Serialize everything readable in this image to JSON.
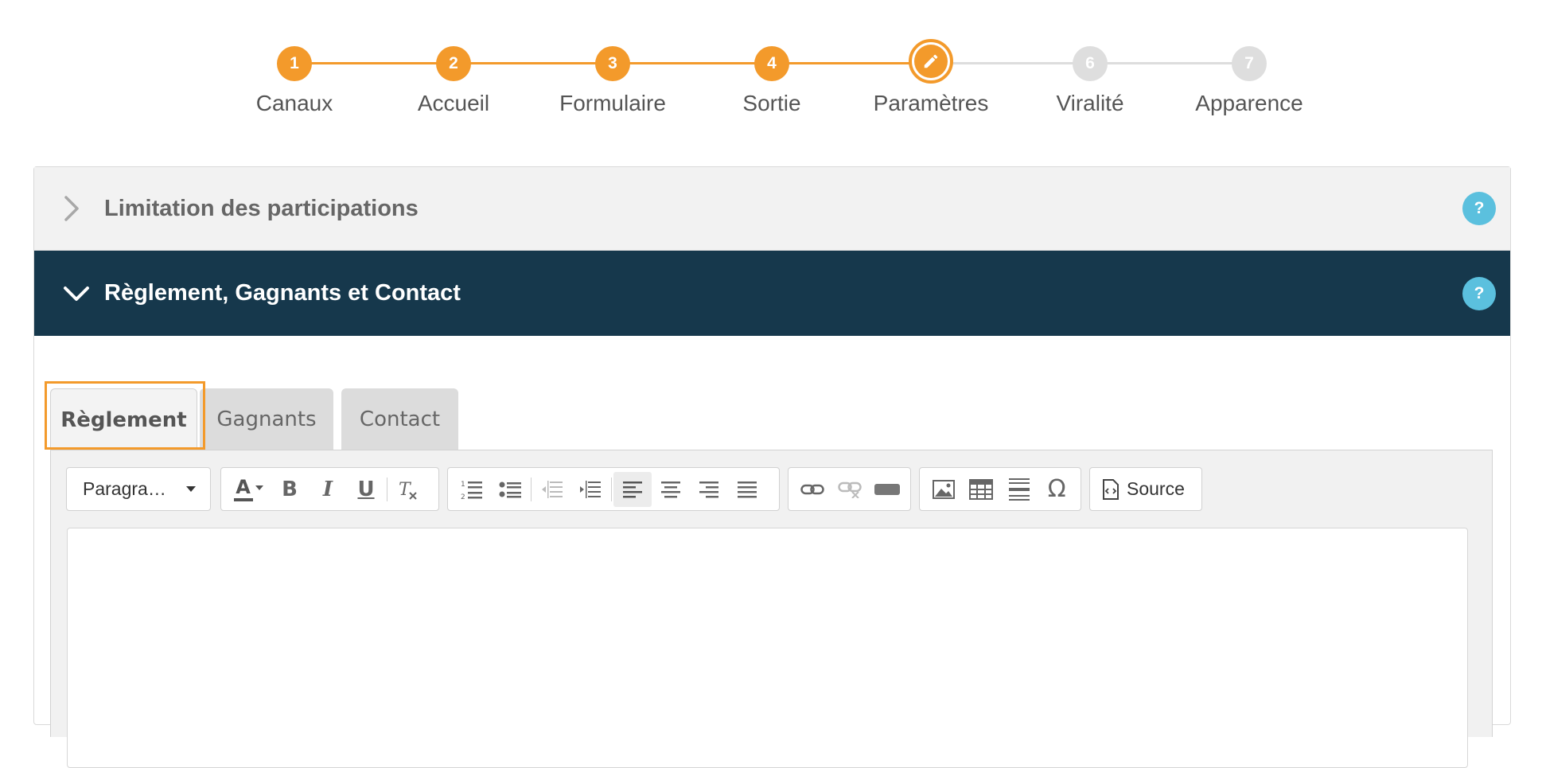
{
  "stepper": {
    "steps": [
      {
        "number": "1",
        "label": "Canaux"
      },
      {
        "number": "2",
        "label": "Accueil"
      },
      {
        "number": "3",
        "label": "Formulaire"
      },
      {
        "number": "4",
        "label": "Sortie"
      },
      {
        "number": "",
        "label": "Paramètres"
      },
      {
        "number": "6",
        "label": "Viralité"
      },
      {
        "number": "7",
        "label": "Apparence"
      }
    ],
    "active_step": 5,
    "active_icon": "pencil-icon"
  },
  "panels": {
    "limitation": {
      "title": "Limitation des participations",
      "help": "?",
      "state": "collapsed"
    },
    "reglement": {
      "title": "Règlement, Gagnants et Contact",
      "help": "?",
      "state": "expanded"
    }
  },
  "tabs": [
    {
      "label": "Règlement",
      "active": true
    },
    {
      "label": "Gagnants",
      "active": false
    },
    {
      "label": "Contact",
      "active": false
    }
  ],
  "toolbar": {
    "format_select": "Paragra…",
    "source_label": "Source",
    "buttons": [
      "text-color-icon",
      "bold-icon",
      "italic-icon",
      "underline-icon",
      "remove-format-icon",
      "numbered-list-icon",
      "bulleted-list-icon",
      "outdent-icon",
      "indent-icon",
      "align-left-icon",
      "align-center-icon",
      "align-right-icon",
      "justify-icon",
      "link-icon",
      "unlink-icon",
      "anchor-icon",
      "image-icon",
      "table-icon",
      "horizontal-line-icon",
      "special-char-icon",
      "source-icon"
    ],
    "bold": "B",
    "italic": "I",
    "underline": "U",
    "omega": "Ω",
    "color_letter": "A"
  },
  "colors": {
    "accent": "#f39a2b",
    "header_dark": "#16384c",
    "help": "#5bc0de",
    "inactive_step": "#dedede"
  }
}
